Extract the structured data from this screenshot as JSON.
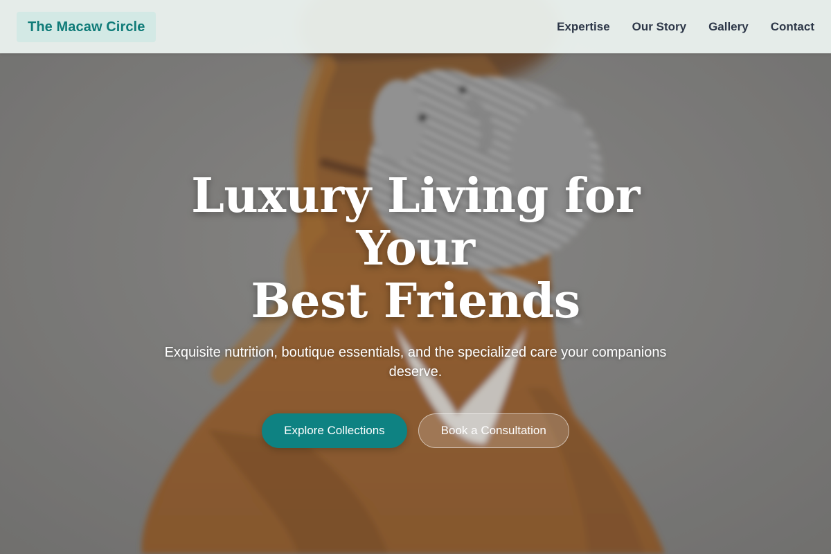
{
  "colors": {
    "brand_text": "#0f7b78",
    "brand_bg": "#d3e9e5",
    "nav_bg": "#eef5f2",
    "nav_text": "#2d3748",
    "primary_button": "#0e8282",
    "hero_text": "#ffffff"
  },
  "header": {
    "brand": "The Macaw Circle",
    "nav": [
      {
        "label": "Expertise"
      },
      {
        "label": "Our Story"
      },
      {
        "label": "Gallery"
      },
      {
        "label": "Contact"
      }
    ]
  },
  "hero": {
    "image_icon": "dog-with-plush-elephant-photo",
    "title_line1": "Luxury Living for Your",
    "title_line2": "Best Friends",
    "subtitle": "Exquisite nutrition, boutique essentials, and the specialized care your companions deserve.",
    "primary_cta": "Explore Collections",
    "secondary_cta": "Book a Consultation"
  }
}
